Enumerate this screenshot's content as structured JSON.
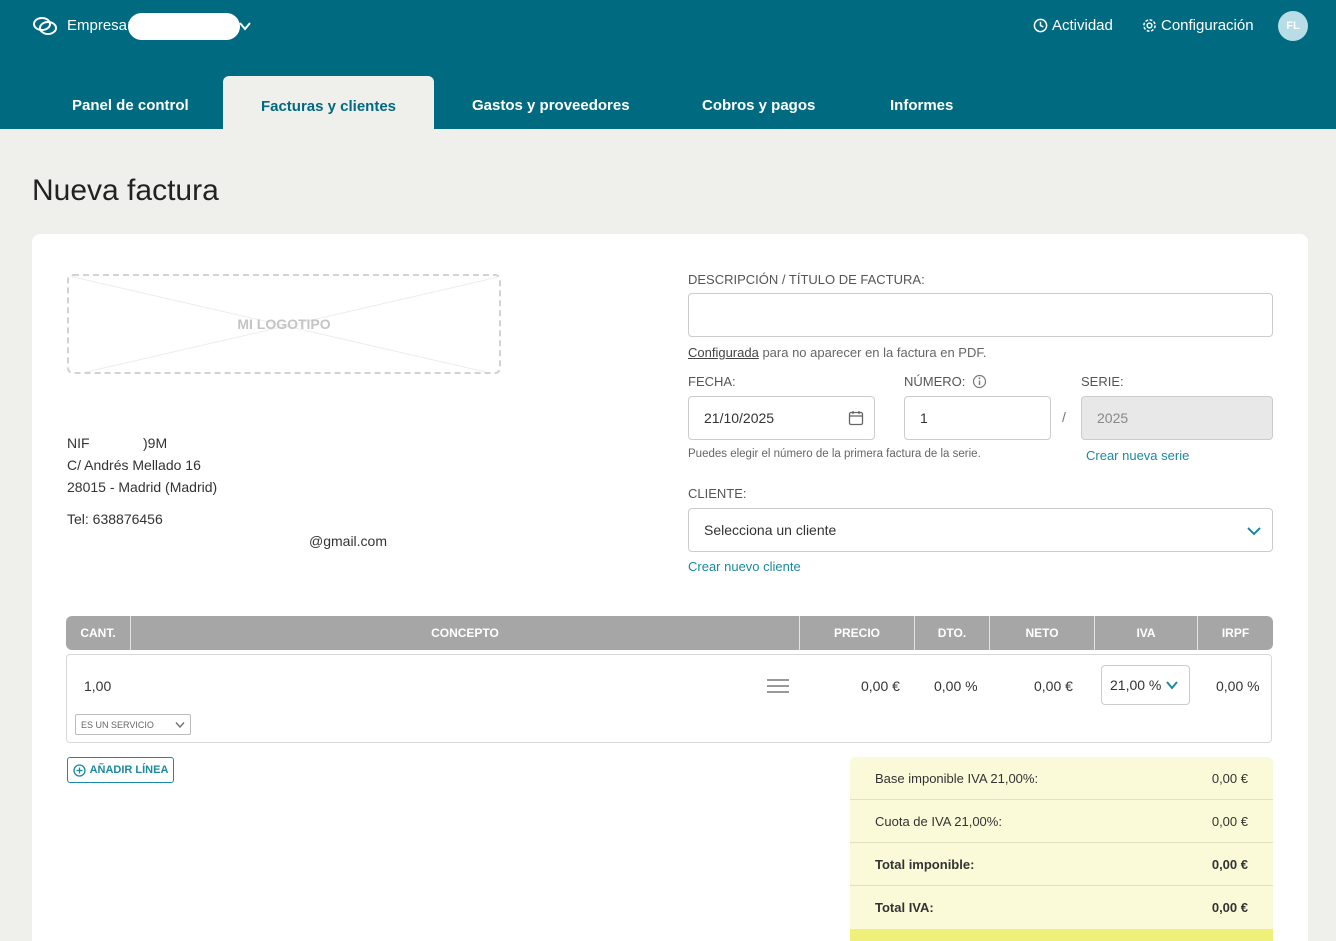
{
  "header": {
    "company_label": "Empresa:",
    "actions": {
      "activity": "Actividad",
      "settings": "Configuración"
    },
    "avatar_initials": "FL"
  },
  "tabs": [
    {
      "label": "Panel de control"
    },
    {
      "label": "Facturas y clientes"
    },
    {
      "label": "Gastos y proveedores"
    },
    {
      "label": "Cobros y pagos"
    },
    {
      "label": "Informes"
    }
  ],
  "page_title": "Nueva factura",
  "logo_placeholder": "MI LOGOTIPO",
  "issuer": {
    "nif_prefix": "NIF",
    "nif_suffix": ")9M",
    "address1": "C/ Andrés Mellado 16",
    "address2": "28015 - Madrid (Madrid)",
    "phone": "Tel: 638876456",
    "email_suffix": "@gmail.com"
  },
  "form": {
    "description_label": "DESCRIPCIÓN / TÍTULO DE FACTURA:",
    "description_value": "",
    "config_link": "Configurada",
    "config_note": " para no aparecer en la factura en PDF.",
    "date_label": "FECHA:",
    "date_value": "21/10/2025",
    "number_label": "NÚMERO:",
    "number_value": "1",
    "series_label": "SERIE:",
    "series_value": "2025",
    "separator": "/",
    "number_help": "Puedes elegir el número de la primera factura de la serie.",
    "new_series_link": "Crear nueva serie",
    "client_label": "CLIENTE:",
    "client_placeholder": "Selecciona un cliente",
    "new_client_link": "Crear nuevo cliente"
  },
  "table": {
    "headers": {
      "qty": "CANT.",
      "concept": "CONCEPTO",
      "price": "PRECIO",
      "discount": "DTO.",
      "net": "NETO",
      "vat": "IVA",
      "irpf": "IRPF"
    },
    "row": {
      "qty": "1,00",
      "price": "0,00 €",
      "discount": "0,00 %",
      "net": "0,00 €",
      "vat": "21,00 %",
      "irpf": "0,00 %",
      "type": "ES UN SERVICIO"
    },
    "add_line": "AÑADIR LÍNEA"
  },
  "totals": [
    {
      "label": "Base imponible IVA 21,00%:",
      "value": "0,00 €"
    },
    {
      "label": "Cuota de IVA 21,00%:",
      "value": "0,00 €"
    },
    {
      "label": "Total imponible:",
      "value": "0,00 €"
    },
    {
      "label": "Total IVA:",
      "value": "0,00 €"
    }
  ],
  "colors": {
    "brand": "#006a80",
    "accent": "#1a8aa0",
    "totals_bg": "#fafad8"
  }
}
